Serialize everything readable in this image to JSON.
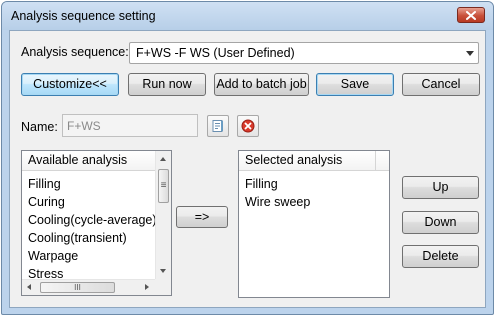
{
  "window": {
    "title": "Analysis sequence setting",
    "close_icon": "close-icon"
  },
  "sequence": {
    "label": "Analysis sequence:",
    "selected": "F+WS -F WS  (User Defined)"
  },
  "toolbar": {
    "customize": "Customize<<",
    "run_now": "Run now",
    "add_batch": "Add to batch job",
    "save": "Save",
    "cancel": "Cancel"
  },
  "name_field": {
    "label": "Name:",
    "value": "F+WS"
  },
  "available": {
    "header": "Available analysis",
    "items": [
      "Filling",
      "Curing",
      "Cooling(cycle-average)",
      "Cooling(transient)",
      "Warpage",
      "Stress"
    ],
    "hscroll_grip": "III",
    "vscroll_grip": "≡"
  },
  "transfer": {
    "label": "=>"
  },
  "selected": {
    "header": "Selected analysis",
    "items": [
      "Filling",
      "Wire sweep"
    ]
  },
  "order_buttons": {
    "up": "Up",
    "down": "Down",
    "delete": "Delete"
  },
  "colors": {
    "accent": "#3c7fb1",
    "close": "#c8503a",
    "titlebar": "#bcd3ec"
  }
}
